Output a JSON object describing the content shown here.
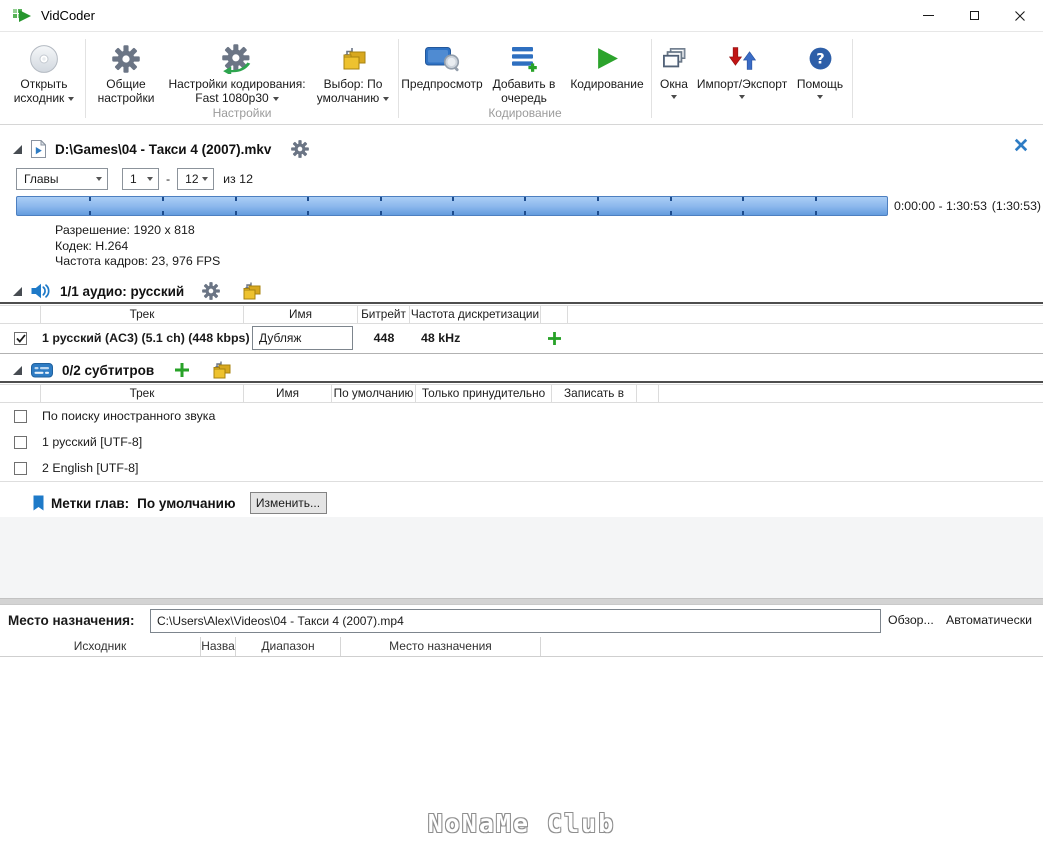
{
  "window": {
    "title": "VidCoder"
  },
  "toolbar": {
    "open_source": {
      "line1": "Открыть",
      "line2": "исходник"
    },
    "general_settings": {
      "line1": "Общие",
      "line2": "настройки"
    },
    "encoding_settings": {
      "line1": "Настройки кодирования:",
      "line2": "Fast 1080p30"
    },
    "picker": {
      "line1": "Выбор: По",
      "line2": "умолчанию"
    },
    "preview": {
      "label": "Предпросмотр"
    },
    "add_to_queue": {
      "line1": "Добавить в",
      "line2": "очередь"
    },
    "encode": {
      "label": "Кодирование"
    },
    "windows": {
      "label": "Окна"
    },
    "import_export": {
      "label": "Импорт/Экспорт"
    },
    "help": {
      "label": "Помощь"
    },
    "group_settings_label": "Настройки",
    "group_encoding_label": "Кодирование"
  },
  "source": {
    "filename": "D:\\Games\\04 - Такси 4 (2007).mkv",
    "range_type": "Главы",
    "range_from": "1",
    "range_dash": "-",
    "range_to": "12",
    "range_total": "из 12",
    "time_range": "0:00:00 - 1:30:53",
    "duration": "(1:30:53)",
    "info_lines": [
      "Разрешение: 1920 x 818",
      "Кодек: H.264",
      "Частота кадров: 23, 976 FPS"
    ]
  },
  "audio": {
    "header": "1/1 аудио: русский",
    "columns": [
      "Трек",
      "Имя",
      "Битрейт",
      "Частота дискретизации"
    ],
    "row": {
      "checked": true,
      "track": "1 русский (AC3) (5.1 ch) (448 kbps)",
      "name_value": "Дубляж",
      "bitrate": "448",
      "sample_rate": "48 kHz"
    }
  },
  "subtitles": {
    "header": "0/2 субтитров",
    "columns": [
      "Трек",
      "Имя",
      "По умолчанию",
      "Только принудительно",
      "Записать в"
    ],
    "rows": [
      {
        "track": "По поиску иностранного звука",
        "checked": false
      },
      {
        "track": "1 русский [UTF-8]",
        "checked": false
      },
      {
        "track": "2 English [UTF-8]",
        "checked": false
      }
    ]
  },
  "chapter_markers": {
    "label": "Метки глав:",
    "value": "По умолчанию",
    "edit_button": "Изменить..."
  },
  "destination": {
    "label": "Место назначения:",
    "path": "C:\\Users\\Alex\\Videos\\04 - Такси 4 (2007).mp4",
    "browse_button": "Обзор...",
    "auto_button": "Автоматически"
  },
  "queue": {
    "columns": [
      "Исходник",
      "Назва",
      "Диапазон",
      "Место назначения"
    ]
  },
  "watermark": "NoNaMe Club",
  "colors": {
    "accent_blue": "#1e7ac8",
    "icon_gray": "#6b7585",
    "green": "#28a228",
    "yellow": "#e4b524",
    "red": "#c01515",
    "timeline_top": "#abcef5",
    "timeline_bottom": "#649cde"
  }
}
